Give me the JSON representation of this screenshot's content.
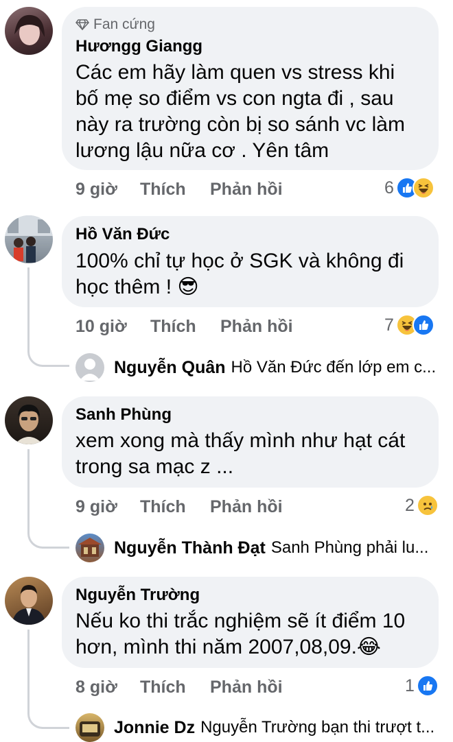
{
  "comments": [
    {
      "badge": "Fan cứng",
      "name": "Hươngg Giangg",
      "lines": [
        "Các em hãy làm quen vs stress khi",
        "bố mẹ so điểm vs con ngta đi , sau",
        "này ra trường còn bị so sánh vc làm",
        "lương lậu nữa cơ . Yên tâm"
      ],
      "time": "9 giờ",
      "like": "Thích",
      "reply": "Phản hồi",
      "reaction_count": "6",
      "reactions": [
        "like-icon",
        "haha-icon"
      ]
    },
    {
      "name": "Hồ Văn Đức",
      "lines": [
        "100% chỉ tự học ở SGK và không đi",
        "học thêm ! 😎"
      ],
      "time": "10 giờ",
      "like": "Thích",
      "reply": "Phản hồi",
      "reaction_count": "7",
      "reactions": [
        "haha-icon",
        "like-icon"
      ],
      "reply_preview": {
        "name": "Nguyễn Quân",
        "text": "Hồ Văn Đức đến lớp em c..."
      }
    },
    {
      "name": "Sanh Phùng",
      "lines": [
        "xem xong mà thấy mình như hạt cát",
        "trong sa mạc z ..."
      ],
      "time": "9 giờ",
      "like": "Thích",
      "reply": "Phản hồi",
      "reaction_count": "2",
      "reactions": [
        "sad-icon"
      ],
      "reply_preview": {
        "name": "Nguyễn Thành Đạt",
        "text": "Sanh Phùng phải lu..."
      }
    },
    {
      "name": "Nguyễn Trường",
      "lines": [
        "Nếu ko thi trắc nghiệm sẽ ít điểm 10",
        "hơn, mình thi năm 2007,08,09.😂"
      ],
      "time": "8 giờ",
      "like": "Thích",
      "reply": "Phản hồi",
      "reaction_count": "1",
      "reactions": [
        "like-icon"
      ],
      "reply_preview": {
        "name": "Jonnie Dz",
        "text": "Nguyễn Trường bạn thi trượt t..."
      }
    }
  ],
  "colors": {
    "bubble": "#f0f2f5",
    "like": "#1877f2",
    "haha": "#f7c33c",
    "meta": "#65676b"
  }
}
